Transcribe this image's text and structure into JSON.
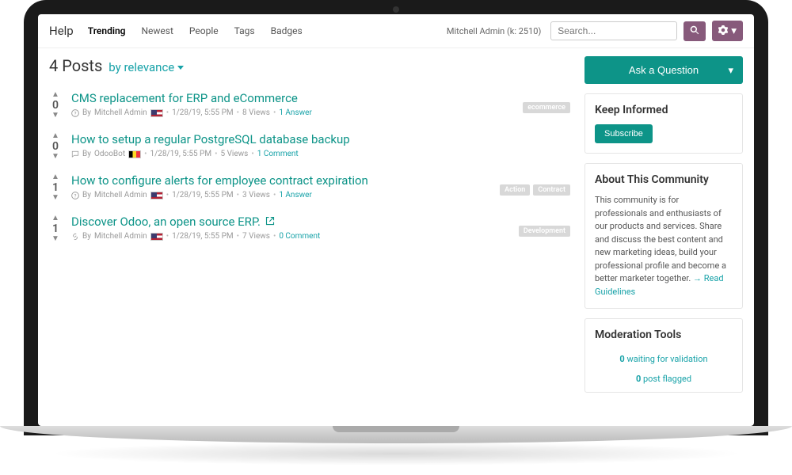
{
  "brand": "Help",
  "nav": [
    "Trending",
    "Newest",
    "People",
    "Tags",
    "Badges"
  ],
  "active_nav": 0,
  "user": {
    "name": "Mitchell Admin",
    "karma_label": "(k: 2510)"
  },
  "search": {
    "placeholder": "Search..."
  },
  "heading": {
    "count": "4 Posts",
    "sort": "by relevance"
  },
  "ask_label": "Ask a Question",
  "posts": [
    {
      "votes": "0",
      "title": "CMS replacement for ERP and eCommerce",
      "icon": "question",
      "author": "Mitchell Admin",
      "flag": "us",
      "date": "1/28/19, 5:55 PM",
      "views": "8 Views",
      "answers": "1 Answer",
      "external": false,
      "tags": [
        "ecommerce"
      ]
    },
    {
      "votes": "0",
      "title": "How to setup a regular PostgreSQL database backup",
      "icon": "comment",
      "author": "OdooBot",
      "flag": "be",
      "date": "1/28/19, 5:55 PM",
      "views": "5 Views",
      "answers": "1 Comment",
      "external": false,
      "tags": []
    },
    {
      "votes": "1",
      "title": "How to configure alerts for employee contract expiration",
      "icon": "question",
      "author": "Mitchell Admin",
      "flag": "us",
      "date": "1/28/19, 5:55 PM",
      "views": "3 Views",
      "answers": "1 Answer",
      "external": false,
      "tags": [
        "Action",
        "Contract"
      ]
    },
    {
      "votes": "1",
      "title": "Discover Odoo, an open source ERP.",
      "icon": "link",
      "author": "Mitchell Admin",
      "flag": "us",
      "date": "1/28/19, 5:55 PM",
      "views": "7 Views",
      "answers": "0 Comment",
      "external": true,
      "tags": [
        "Development"
      ]
    }
  ],
  "sidebar": {
    "keep_informed": {
      "title": "Keep Informed",
      "subscribe": "Subscribe"
    },
    "about": {
      "title": "About This Community",
      "text": "This community is for professionals and enthusiasts of our products and services. Share and discuss the best content and new marketing ideas, build your professional profile and become a better marketer together.",
      "read_link": "Read Guidelines"
    },
    "moderation": {
      "title": "Moderation Tools",
      "items": [
        {
          "count": "0",
          "label": "waiting for validation"
        },
        {
          "count": "0",
          "label": "post flagged"
        }
      ]
    }
  },
  "by_label": "By"
}
